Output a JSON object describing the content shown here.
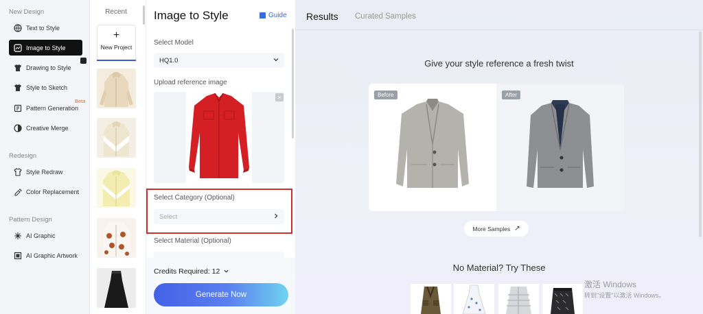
{
  "nav": {
    "sections": [
      "New Design",
      "Redesign",
      "Pattern Design"
    ],
    "items": [
      {
        "label": "Text to Style",
        "icon": "globe-icon"
      },
      {
        "label": "Image to Style",
        "icon": "image-style-icon",
        "active": true
      },
      {
        "label": "Drawing to Style",
        "icon": "shirt-icon"
      },
      {
        "label": "Style to Sketch",
        "icon": "shirt-icon"
      },
      {
        "label": "Pattern Generation",
        "icon": "pattern-icon",
        "badge": "Beta"
      },
      {
        "label": "Creative Merge",
        "icon": "merge-icon"
      },
      {
        "label": "Style Redraw",
        "icon": "redraw-icon"
      },
      {
        "label": "Color Replacement",
        "icon": "palette-icon"
      },
      {
        "label": "AI Graphic",
        "icon": "graphic-icon"
      },
      {
        "label": "AI Graphic Artwork",
        "icon": "artwork-icon"
      }
    ]
  },
  "recent": {
    "title": "Recent",
    "new_project": "New Project",
    "plus": "+"
  },
  "panel": {
    "title": "Image to Style",
    "guide": "Guide",
    "model_label": "Select Model",
    "model_value": "HQ1.0",
    "upload_label": "Upload reference image",
    "close": "×",
    "category_label": "Select Category (Optional)",
    "category_placeholder": "Select",
    "material_label": "Select Material (Optional)",
    "credits": "Credits Required: 12",
    "generate": "Generate Now"
  },
  "results": {
    "tab_results": "Results",
    "tab_samples": "Curated Samples",
    "headline": "Give your style reference a fresh twist",
    "before": "Before",
    "after": "After",
    "more_samples": "More Samples",
    "no_material": "No Material? Try These"
  },
  "watermark": {
    "line1": "激活 Windows",
    "line2": "转到\"设置\"以激活 Windows。"
  },
  "colors": {
    "accent": "#3a57e8",
    "highlight": "#d42b2b",
    "beta": "#e06a2a"
  }
}
